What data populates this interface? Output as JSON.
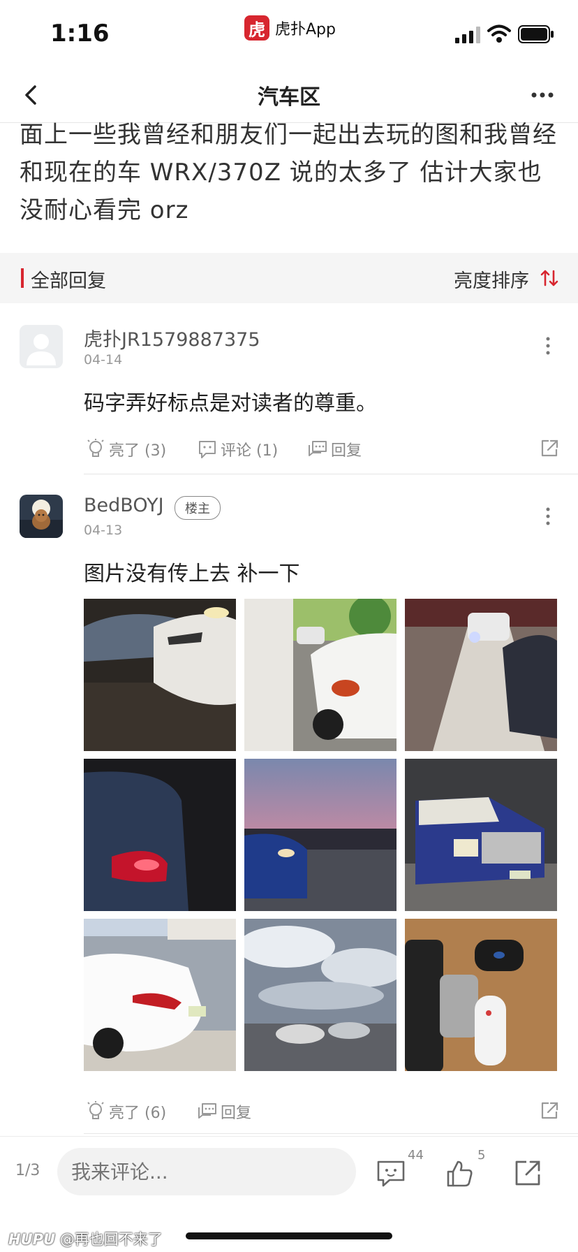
{
  "status_bar": {
    "time": "1:16",
    "app_logo_glyph": "虎",
    "app_name": "虎扑App"
  },
  "nav": {
    "title": "汽车区"
  },
  "post": {
    "text": "面上一些我曾经和朋友们一起出去玩的图和我曾经 和现在的车 WRX/370Z 说的太多了 估计大家也没耐心看完 orz"
  },
  "replies_header": {
    "title": "全部回复",
    "sort_label": "亮度排序",
    "accent_color": "#d7262f"
  },
  "comments": [
    {
      "username": "虎扑JR1579887375",
      "date": "04-14",
      "text": "码字弄好标点是对读者的尊重。",
      "like_label": "亮了 (3)",
      "comment_label": "评论 (1)",
      "reply_label": "回复"
    },
    {
      "username": "BedBOYJ",
      "badge": "楼主",
      "date": "04-13",
      "text": "图片没有传上去 补一下",
      "like_label": "亮了 (6)",
      "reply_label": "回复",
      "image_labels": [
        "",
        "",
        "",
        "",
        "",
        "",
        "",
        "",
        ""
      ]
    }
  ],
  "bottom_bar": {
    "page": "1/3",
    "input_placeholder": "我来评论...",
    "comment_count": "44",
    "like_count": "5"
  },
  "watermark": {
    "brand": "HUPU",
    "handle": "@再也回不来了"
  }
}
